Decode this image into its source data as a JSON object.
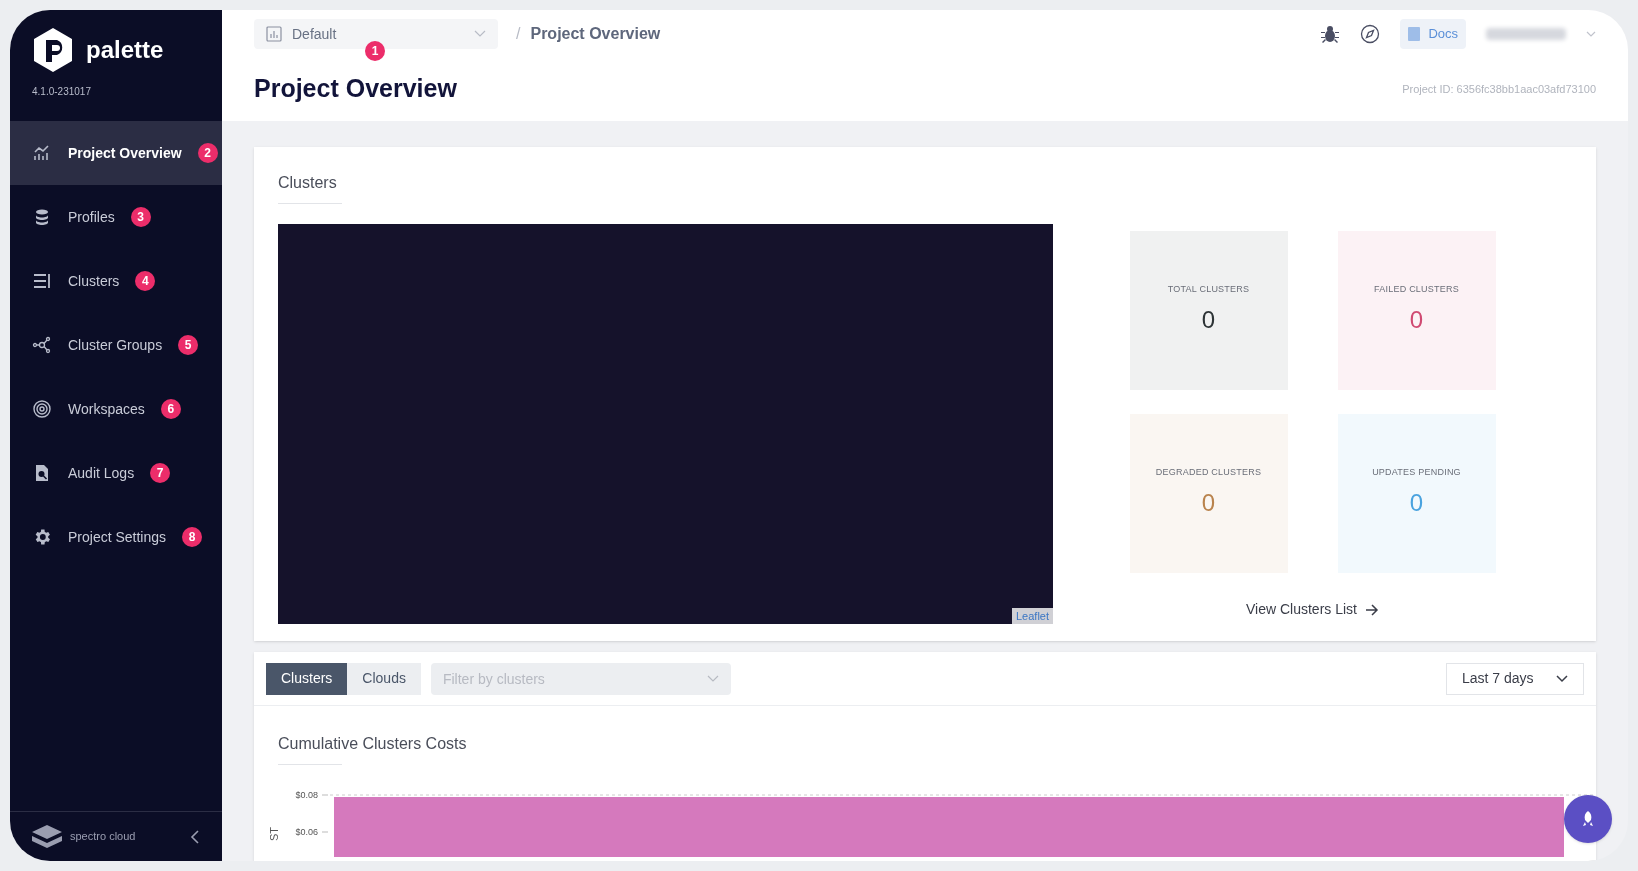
{
  "sidebar": {
    "logo": "palette",
    "version": "4.1.0-231017",
    "items": [
      {
        "label": "Project Overview",
        "badge": "2",
        "selected": true
      },
      {
        "label": "Profiles",
        "badge": "3",
        "selected": false
      },
      {
        "label": "Clusters",
        "badge": "4",
        "selected": false
      },
      {
        "label": "Cluster Groups",
        "badge": "5",
        "selected": false
      },
      {
        "label": "Workspaces",
        "badge": "6",
        "selected": false
      },
      {
        "label": "Audit Logs",
        "badge": "7",
        "selected": false
      },
      {
        "label": "Project Settings",
        "badge": "8",
        "selected": false
      }
    ],
    "footer": "spectro cloud"
  },
  "header": {
    "project_select": {
      "value": "Default",
      "badge": "1"
    },
    "breadcrumb_separator": "/",
    "breadcrumb": "Project Overview",
    "docs": "Docs",
    "title": "Project Overview",
    "project_id": "Project ID: 6356fc38bb1aac03afd73100"
  },
  "clusters_panel": {
    "title": "Clusters",
    "map_attribution": "Leaflet",
    "stats": [
      {
        "label": "TOTAL CLUSTERS",
        "value": "0",
        "color": "#2d3436"
      },
      {
        "label": "FAILED CLUSTERS",
        "value": "0",
        "color": "#d04a72"
      },
      {
        "label": "DEGRADED CLUSTERS",
        "value": "0",
        "color": "#b9834d"
      },
      {
        "label": "UPDATES PENDING",
        "value": "0",
        "color": "#4aa3df"
      }
    ],
    "link": "View Clusters List"
  },
  "costs": {
    "tabs": [
      {
        "label": "Clusters",
        "selected": true
      },
      {
        "label": "Clouds",
        "selected": false
      }
    ],
    "filter": {
      "placeholder": "Filter by clusters"
    },
    "range": "Last 7 days",
    "title": "Cumulative Clusters Costs",
    "chart": {
      "ylabel": "ST",
      "ytick_labels": [
        "$0.08",
        "$0.06"
      ]
    }
  }
}
